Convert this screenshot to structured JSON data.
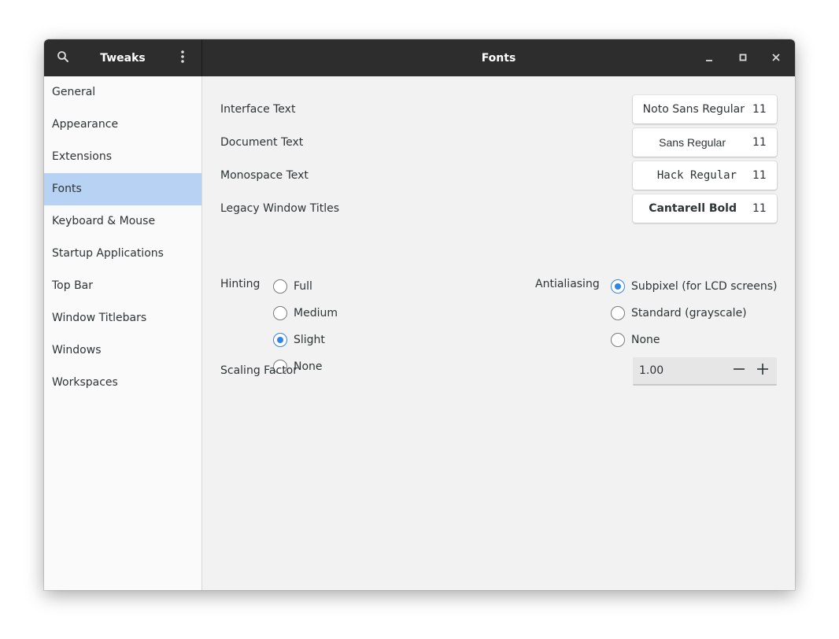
{
  "headerbar": {
    "app_title": "Tweaks",
    "page_title": "Fonts",
    "search_icon": "search-icon",
    "menu_icon": "vertical-dots-icon",
    "minimize_icon": "minimize-icon",
    "maximize_icon": "maximize-icon",
    "close_icon": "close-icon"
  },
  "sidebar": {
    "selected_index": 3,
    "items": [
      {
        "label": "General"
      },
      {
        "label": "Appearance"
      },
      {
        "label": "Extensions"
      },
      {
        "label": "Fonts"
      },
      {
        "label": "Keyboard & Mouse"
      },
      {
        "label": "Startup Applications"
      },
      {
        "label": "Top Bar"
      },
      {
        "label": "Window Titlebars"
      },
      {
        "label": "Windows"
      },
      {
        "label": "Workspaces"
      }
    ]
  },
  "fonts": [
    {
      "label": "Interface Text",
      "font": "Noto Sans Regular",
      "size": "11"
    },
    {
      "label": "Document Text",
      "font": "Sans Regular",
      "size": "11"
    },
    {
      "label": "Monospace Text",
      "font": "Hack Regular",
      "size": "11"
    },
    {
      "label": "Legacy Window Titles",
      "font": "Cantarell Bold",
      "size": "11"
    }
  ],
  "hinting": {
    "label": "Hinting",
    "options": [
      {
        "label": "Full",
        "checked": false
      },
      {
        "label": "Medium",
        "checked": false
      },
      {
        "label": "Slight",
        "checked": true
      },
      {
        "label": "None",
        "checked": false
      }
    ]
  },
  "antialiasing": {
    "label": "Antialiasing",
    "options": [
      {
        "label": "Subpixel (for LCD screens)",
        "checked": true
      },
      {
        "label": "Standard (grayscale)",
        "checked": false
      },
      {
        "label": "None",
        "checked": false
      }
    ]
  },
  "scaling": {
    "label": "Scaling Factor",
    "value": "1.00",
    "minus_icon": "minus-icon",
    "plus_icon": "plus-icon"
  },
  "colors": {
    "headerbar": "#2d2d2d",
    "selection": "#b8d2f4",
    "accent": "#3584e4"
  }
}
